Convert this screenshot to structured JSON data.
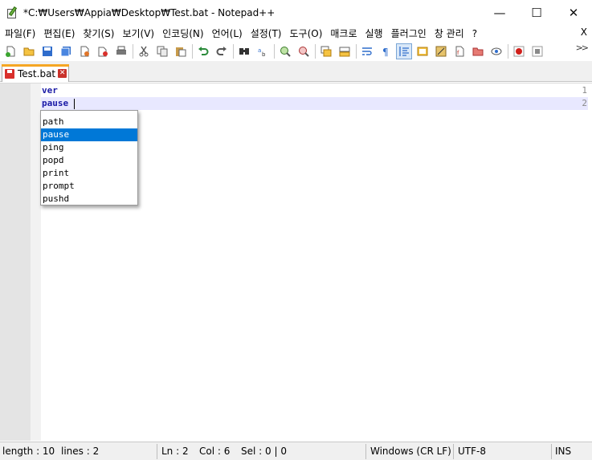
{
  "window": {
    "title": "*C:₩Users₩Appia₩Desktop₩Test.bat - Notepad++",
    "minimize_glyph": "—",
    "maximize_glyph": "☐",
    "close_glyph": "✕"
  },
  "menu": {
    "items": [
      "파일(F)",
      "편집(E)",
      "찾기(S)",
      "보기(V)",
      "인코딩(N)",
      "언어(L)",
      "설정(T)",
      "도구(O)",
      "매크로",
      "실행",
      "플러그인",
      "창 관리",
      "?"
    ],
    "close_label": "X"
  },
  "toolbar": {
    "icons": [
      "new-file-icon",
      "open-file-icon",
      "save-icon",
      "save-all-icon",
      "close-icon",
      "close-all-icon",
      "print-icon",
      "cut-icon",
      "copy-icon",
      "paste-icon",
      "undo-icon",
      "redo-icon",
      "find-icon",
      "replace-icon",
      "zoom-in-icon",
      "zoom-out-icon",
      "sync-vertical-icon",
      "sync-horizontal-icon",
      "word-wrap-icon",
      "show-all-characters-icon",
      "indent-guide-icon",
      "user-defined-language-icon",
      "document-map-icon",
      "function-list-icon",
      "folder-as-workspace-icon",
      "monitoring-icon",
      "record-macro-icon",
      "stop-macro-icon"
    ],
    "more_label": ">>"
  },
  "tab": {
    "label": "Test.bat",
    "close_glyph": "✕"
  },
  "editor": {
    "lines": [
      {
        "number": "1",
        "text": "ver"
      },
      {
        "number": "2",
        "text": "pause"
      }
    ]
  },
  "autocomplete": {
    "items": [
      "path",
      "pause",
      "ping",
      "popd",
      "print",
      "prompt",
      "pushd"
    ],
    "selected": "pause"
  },
  "status": {
    "length": "length : 10",
    "lines": "lines : 2",
    "ln": "Ln : 2",
    "col": "Col : 6",
    "sel": "Sel : 0 | 0",
    "eol": "Windows (CR LF)",
    "encoding": "UTF-8",
    "mode": "INS"
  },
  "colors": {
    "keyword": "#1a1aa6",
    "selection": "#0078d7",
    "current_line": "#e8e8ff",
    "tab_accent": "#f5a623"
  }
}
